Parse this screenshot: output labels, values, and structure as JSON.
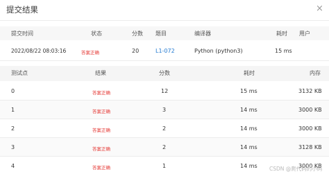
{
  "dialog": {
    "title": "提交结果",
    "close_label": "×"
  },
  "submission": {
    "headers": {
      "time": "提交时间",
      "status": "状态",
      "score": "分数",
      "problem": "题目",
      "compiler": "编译器",
      "runtime": "耗时",
      "user": "用户"
    },
    "row": {
      "time": "2022/08/22 08:03:16",
      "status": "答案正确",
      "score": "20",
      "problem": "L1-072",
      "compiler": "Python (python3)",
      "runtime": "15 ms",
      "user": ""
    }
  },
  "testpoints": {
    "headers": {
      "index": "测试点",
      "result": "结果",
      "score": "分数",
      "runtime": "耗时",
      "memory": "内存"
    },
    "rows": [
      {
        "index": "0",
        "result": "答案正确",
        "score": "12",
        "runtime": "15 ms",
        "memory": "3132 KB"
      },
      {
        "index": "1",
        "result": "答案正确",
        "score": "3",
        "runtime": "14 ms",
        "memory": "3000 KB"
      },
      {
        "index": "2",
        "result": "答案正确",
        "score": "2",
        "runtime": "14 ms",
        "memory": "3000 KB"
      },
      {
        "index": "3",
        "result": "答案正确",
        "score": "2",
        "runtime": "14 ms",
        "memory": "3128 KB"
      },
      {
        "index": "4",
        "result": "答案正确",
        "score": "1",
        "runtime": "14 ms",
        "memory": "3000 KB"
      }
    ]
  },
  "watermark": "CSDN @爬代码的小码"
}
